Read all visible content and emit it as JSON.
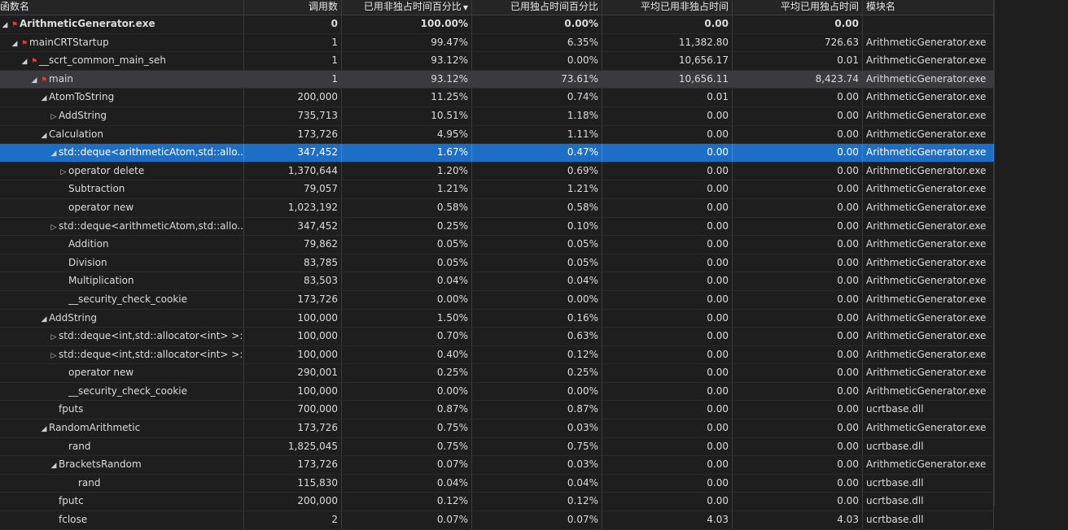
{
  "columns": {
    "name": "函数名",
    "calls": "调用数",
    "incl_pct": "已用非独占时间百分比",
    "excl_pct": "已用独占时间百分比",
    "avg_incl": "平均已用非独占时间",
    "avg_excl": "平均已用独占时间",
    "module": "模块名"
  },
  "rows": [
    {
      "name": "ArithmeticGenerator.exe",
      "calls": "0",
      "incl": "100.00%",
      "excl": "0.00%",
      "ai": "0.00",
      "ae": "0.00",
      "mod": "",
      "depth": 0,
      "tog": "open",
      "hot": true,
      "bold": true
    },
    {
      "name": "mainCRTStartup",
      "calls": "1",
      "incl": "99.47%",
      "excl": "6.35%",
      "ai": "11,382.80",
      "ae": "726.63",
      "mod": "ArithmeticGenerator.exe",
      "depth": 1,
      "tog": "open",
      "hot": true
    },
    {
      "name": "__scrt_common_main_seh",
      "calls": "1",
      "incl": "93.12%",
      "excl": "0.00%",
      "ai": "10,656.17",
      "ae": "0.01",
      "mod": "ArithmeticGenerator.exe",
      "depth": 2,
      "tog": "open",
      "hot": true
    },
    {
      "name": "main",
      "calls": "1",
      "incl": "93.12%",
      "excl": "73.61%",
      "ai": "10,656.11",
      "ae": "8,423.74",
      "mod": "ArithmeticGenerator.exe",
      "depth": 3,
      "tog": "open",
      "hot": true,
      "hl": true
    },
    {
      "name": "AtomToString",
      "calls": "200,000",
      "incl": "11.25%",
      "excl": "0.74%",
      "ai": "0.01",
      "ae": "0.00",
      "mod": "ArithmeticGenerator.exe",
      "depth": 4,
      "tog": "open"
    },
    {
      "name": "AddString",
      "calls": "735,713",
      "incl": "10.51%",
      "excl": "1.18%",
      "ai": "0.00",
      "ae": "0.00",
      "mod": "ArithmeticGenerator.exe",
      "depth": 5,
      "tog": "closed"
    },
    {
      "name": "Calculation",
      "calls": "173,726",
      "incl": "4.95%",
      "excl": "1.11%",
      "ai": "0.00",
      "ae": "0.00",
      "mod": "ArithmeticGenerator.exe",
      "depth": 4,
      "tog": "open"
    },
    {
      "name": "std::deque<arithmeticAtom,std::allo...",
      "calls": "347,452",
      "incl": "1.67%",
      "excl": "0.47%",
      "ai": "0.00",
      "ae": "0.00",
      "mod": "ArithmeticGenerator.exe",
      "depth": 5,
      "tog": "open",
      "selected": true
    },
    {
      "name": "operator delete",
      "calls": "1,370,644",
      "incl": "1.20%",
      "excl": "0.69%",
      "ai": "0.00",
      "ae": "0.00",
      "mod": "ArithmeticGenerator.exe",
      "depth": 6,
      "tog": "closed"
    },
    {
      "name": "Subtraction",
      "calls": "79,057",
      "incl": "1.21%",
      "excl": "1.21%",
      "ai": "0.00",
      "ae": "0.00",
      "mod": "ArithmeticGenerator.exe",
      "depth": 6,
      "tog": "none"
    },
    {
      "name": "operator new",
      "calls": "1,023,192",
      "incl": "0.58%",
      "excl": "0.58%",
      "ai": "0.00",
      "ae": "0.00",
      "mod": "ArithmeticGenerator.exe",
      "depth": 6,
      "tog": "none"
    },
    {
      "name": "std::deque<arithmeticAtom,std::allo...",
      "calls": "347,452",
      "incl": "0.25%",
      "excl": "0.10%",
      "ai": "0.00",
      "ae": "0.00",
      "mod": "ArithmeticGenerator.exe",
      "depth": 5,
      "tog": "closed"
    },
    {
      "name": "Addition",
      "calls": "79,862",
      "incl": "0.05%",
      "excl": "0.05%",
      "ai": "0.00",
      "ae": "0.00",
      "mod": "ArithmeticGenerator.exe",
      "depth": 6,
      "tog": "none"
    },
    {
      "name": "Division",
      "calls": "83,785",
      "incl": "0.05%",
      "excl": "0.05%",
      "ai": "0.00",
      "ae": "0.00",
      "mod": "ArithmeticGenerator.exe",
      "depth": 6,
      "tog": "none"
    },
    {
      "name": "Multiplication",
      "calls": "83,503",
      "incl": "0.04%",
      "excl": "0.04%",
      "ai": "0.00",
      "ae": "0.00",
      "mod": "ArithmeticGenerator.exe",
      "depth": 6,
      "tog": "none"
    },
    {
      "name": "__security_check_cookie",
      "calls": "173,726",
      "incl": "0.00%",
      "excl": "0.00%",
      "ai": "0.00",
      "ae": "0.00",
      "mod": "ArithmeticGenerator.exe",
      "depth": 6,
      "tog": "none"
    },
    {
      "name": "AddString",
      "calls": "100,000",
      "incl": "1.50%",
      "excl": "0.16%",
      "ai": "0.00",
      "ae": "0.00",
      "mod": "ArithmeticGenerator.exe",
      "depth": 4,
      "tog": "open"
    },
    {
      "name": "std::deque<int,std::allocator<int> >::...",
      "calls": "100,000",
      "incl": "0.70%",
      "excl": "0.63%",
      "ai": "0.00",
      "ae": "0.00",
      "mod": "ArithmeticGenerator.exe",
      "depth": 5,
      "tog": "closed"
    },
    {
      "name": "std::deque<int,std::allocator<int> >::...",
      "calls": "100,000",
      "incl": "0.40%",
      "excl": "0.12%",
      "ai": "0.00",
      "ae": "0.00",
      "mod": "ArithmeticGenerator.exe",
      "depth": 5,
      "tog": "closed"
    },
    {
      "name": "operator new",
      "calls": "290,001",
      "incl": "0.25%",
      "excl": "0.25%",
      "ai": "0.00",
      "ae": "0.00",
      "mod": "ArithmeticGenerator.exe",
      "depth": 6,
      "tog": "none"
    },
    {
      "name": "__security_check_cookie",
      "calls": "100,000",
      "incl": "0.00%",
      "excl": "0.00%",
      "ai": "0.00",
      "ae": "0.00",
      "mod": "ArithmeticGenerator.exe",
      "depth": 6,
      "tog": "none"
    },
    {
      "name": "fputs",
      "calls": "700,000",
      "incl": "0.87%",
      "excl": "0.87%",
      "ai": "0.00",
      "ae": "0.00",
      "mod": "ucrtbase.dll",
      "depth": 5,
      "tog": "none"
    },
    {
      "name": "RandomArithmetic",
      "calls": "173,726",
      "incl": "0.75%",
      "excl": "0.03%",
      "ai": "0.00",
      "ae": "0.00",
      "mod": "ArithmeticGenerator.exe",
      "depth": 4,
      "tog": "open"
    },
    {
      "name": "rand",
      "calls": "1,825,045",
      "incl": "0.75%",
      "excl": "0.75%",
      "ai": "0.00",
      "ae": "0.00",
      "mod": "ucrtbase.dll",
      "depth": 6,
      "tog": "none"
    },
    {
      "name": "BracketsRandom",
      "calls": "173,726",
      "incl": "0.07%",
      "excl": "0.03%",
      "ai": "0.00",
      "ae": "0.00",
      "mod": "ArithmeticGenerator.exe",
      "depth": 5,
      "tog": "open"
    },
    {
      "name": "rand",
      "calls": "115,830",
      "incl": "0.04%",
      "excl": "0.04%",
      "ai": "0.00",
      "ae": "0.00",
      "mod": "ucrtbase.dll",
      "depth": 7,
      "tog": "none"
    },
    {
      "name": "fputc",
      "calls": "200,000",
      "incl": "0.12%",
      "excl": "0.12%",
      "ai": "0.00",
      "ae": "0.00",
      "mod": "ucrtbase.dll",
      "depth": 5,
      "tog": "none"
    },
    {
      "name": "fclose",
      "calls": "2",
      "incl": "0.07%",
      "excl": "0.07%",
      "ai": "4.03",
      "ae": "4.03",
      "mod": "ucrtbase.dll",
      "depth": 5,
      "tog": "none"
    }
  ]
}
